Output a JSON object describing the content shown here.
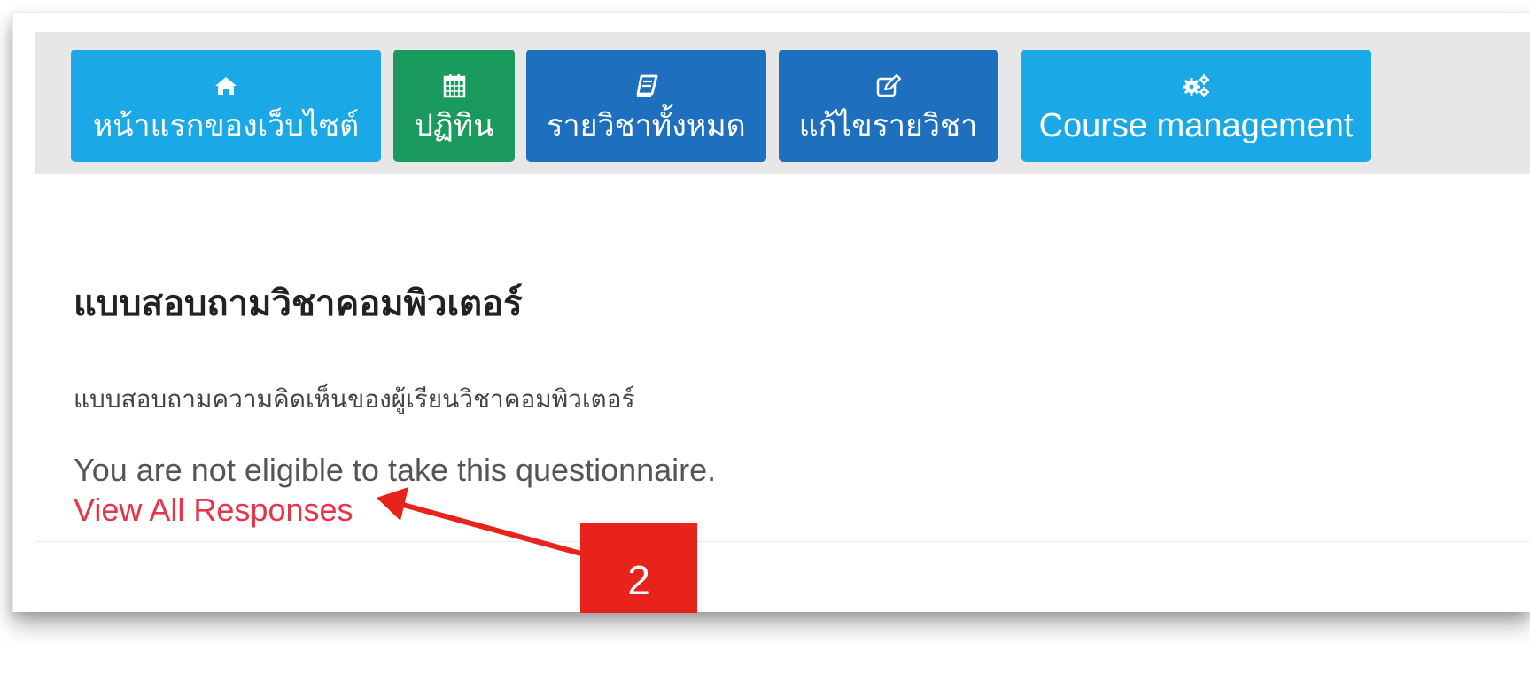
{
  "navbar": {
    "buttons": [
      {
        "label": "หน้าแรกของเว็บไซต์",
        "icon": "home-icon",
        "color": "#1aa9e6"
      },
      {
        "label": "ปฏิทิน",
        "icon": "calendar-icon",
        "color": "#1a9a5c"
      },
      {
        "label": "รายวิชาทั้งหมด",
        "icon": "book-icon",
        "color": "#1f6fbf"
      },
      {
        "label": "แก้ไขรายวิชา",
        "icon": "edit-icon",
        "color": "#1f6fbf"
      },
      {
        "label": "Course management",
        "icon": "gears-icon",
        "color": "#1aa9e6"
      }
    ]
  },
  "questionnaire": {
    "title": "แบบสอบถามวิชาคอมพิวเตอร์",
    "description": "แบบสอบถามความคิดเห็นของผู้เรียนวิชาคอมพิวเตอร์",
    "notice": "You are not eligible to take this questionnaire.",
    "view_responses_link": "View All Responses"
  },
  "annotation": {
    "badge_number": "2",
    "color": "#e8231b"
  }
}
